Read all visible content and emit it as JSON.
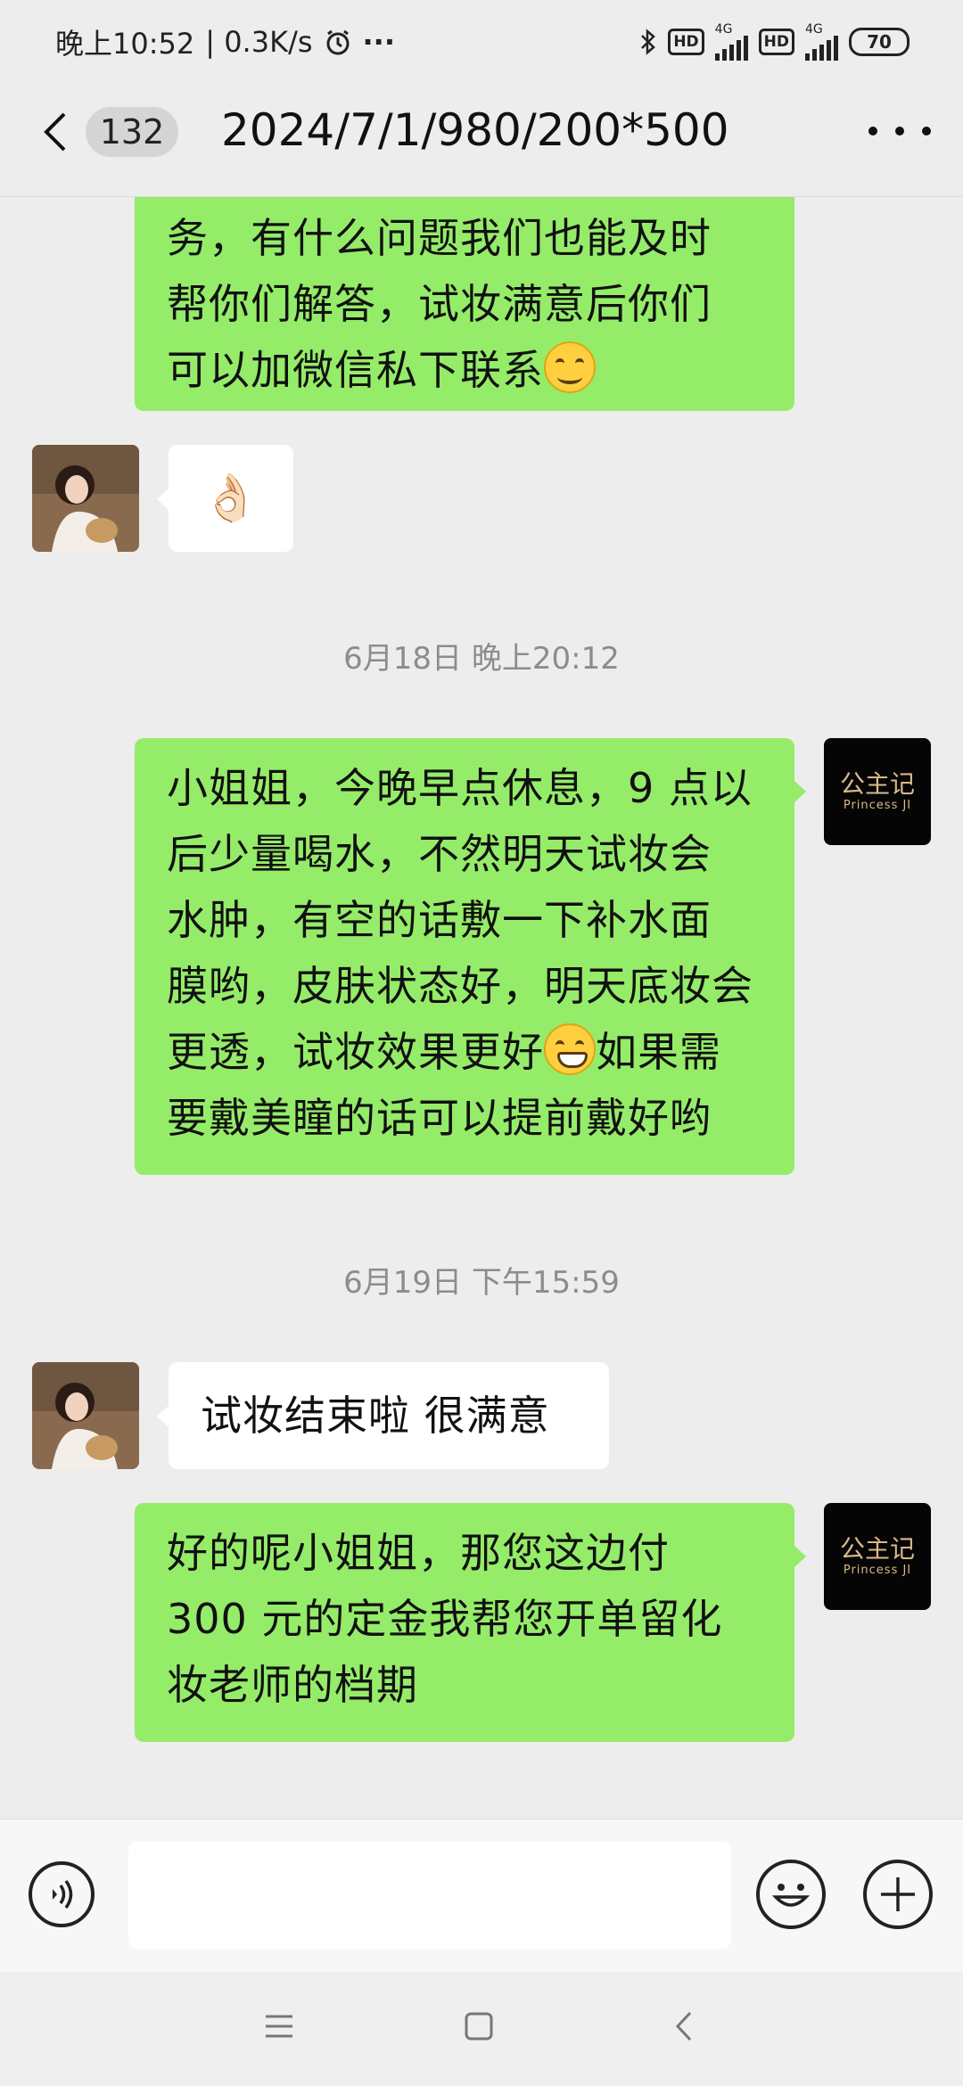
{
  "status_bar": {
    "time": "晚上10:52",
    "speed": "| 0.3K/s",
    "more": "···",
    "hd1": "HD",
    "net1": "4G",
    "hd2": "HD",
    "net2": "4G",
    "battery": "70"
  },
  "header": {
    "unread_count": "132",
    "title": "2024/7/1/980/200*500"
  },
  "shop_avatar": {
    "name": "公主记",
    "subtitle": "Princess JI"
  },
  "messages": [
    {
      "sender": "me",
      "lines": [
        "务，有什么问题我们也能及时",
        "帮你们解答，试妆满意后你们",
        "可以加微信私下联系"
      ],
      "emoji": "smiling-face"
    },
    {
      "sender": "customer",
      "lines": [
        "👌🏻"
      ]
    },
    {
      "type": "time",
      "text": "6月18日 晚上20:12"
    },
    {
      "sender": "me",
      "lines": [
        "小姐姐，今晚早点休息，9 点以",
        "后少量喝水，不然明天试妆会",
        "水肿，有空的话敷一下补水面",
        "膜哟，皮肤状态好，明天底妆会",
        "更透，试妆效果更好",
        "如果需",
        "要戴美瞳的话可以提前戴好哟"
      ],
      "emoji": "grinning-face"
    },
    {
      "type": "time",
      "text": "6月19日 下午15:59"
    },
    {
      "sender": "customer",
      "lines": [
        "试妆结束啦 很满意"
      ]
    },
    {
      "sender": "me",
      "lines": [
        "好的呢小姐姐，那您这边付",
        "300 元的定金我帮您开单留化",
        "妆老师的档期"
      ]
    }
  ],
  "input_bar": {
    "placeholder": ""
  },
  "colors": {
    "outgoing_bubble": "#95ec69",
    "incoming_bubble": "#ffffff",
    "background": "#ededed"
  }
}
